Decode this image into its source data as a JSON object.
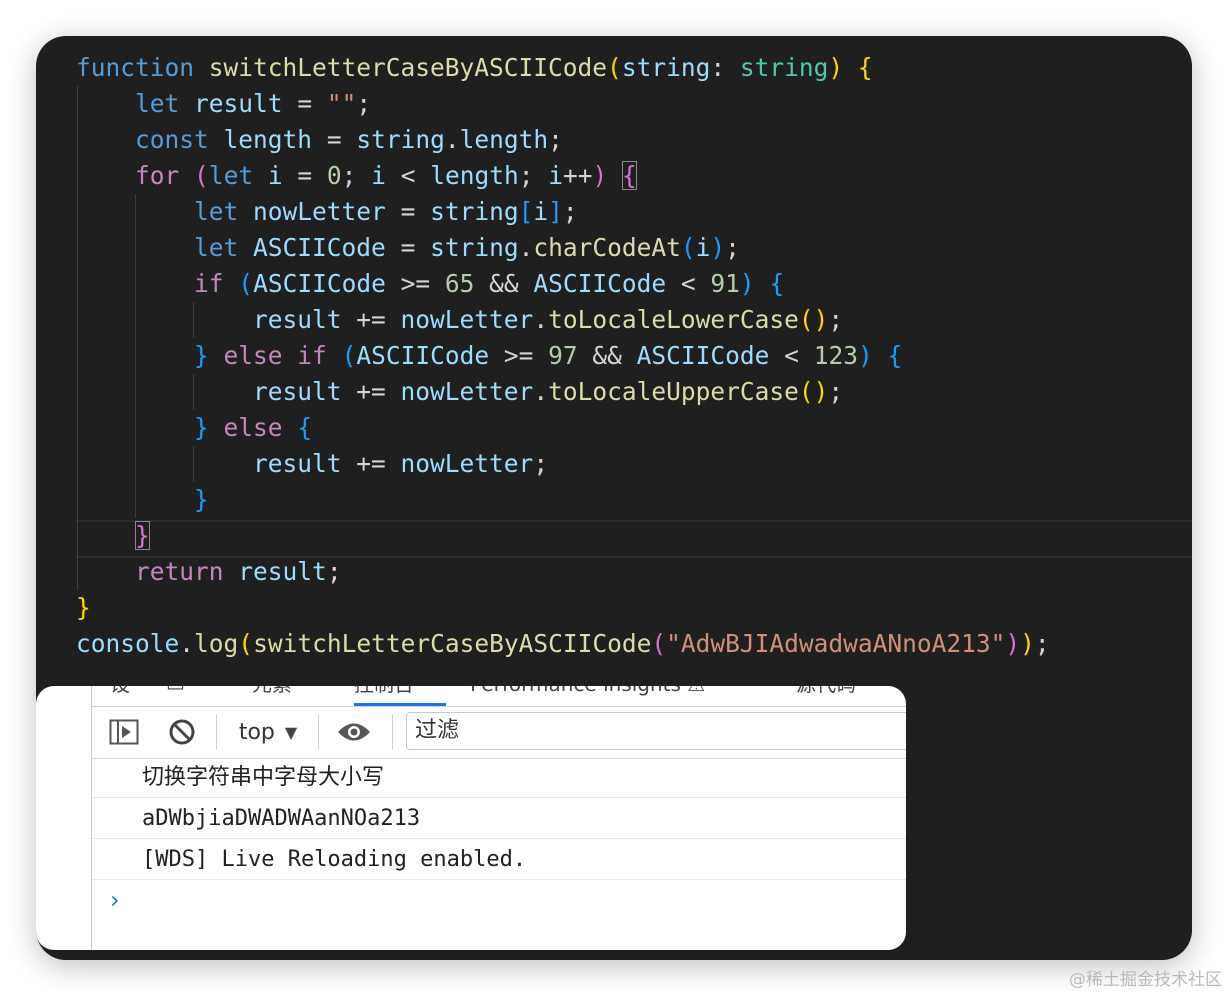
{
  "editor": {
    "lines": [
      [
        [
          "kw",
          "function"
        ],
        [
          "pn",
          " "
        ],
        [
          "fn",
          "switchLetterCaseByASCIICode"
        ],
        [
          "b1",
          "("
        ],
        [
          "vr",
          "string"
        ],
        [
          "pn",
          ": "
        ],
        [
          "ty",
          "string"
        ],
        [
          "b1",
          ")"
        ],
        [
          "pn",
          " "
        ],
        [
          "b1",
          "{"
        ]
      ],
      [
        [
          "pn",
          "    "
        ],
        [
          "kw",
          "let"
        ],
        [
          "pn",
          " "
        ],
        [
          "vr",
          "result"
        ],
        [
          "pn",
          " = "
        ],
        [
          "st",
          "\"\""
        ],
        [
          "pn",
          ";"
        ]
      ],
      [
        [
          "pn",
          "    "
        ],
        [
          "kw",
          "const"
        ],
        [
          "pn",
          " "
        ],
        [
          "vr",
          "length"
        ],
        [
          "pn",
          " = "
        ],
        [
          "vr",
          "string"
        ],
        [
          "pn",
          "."
        ],
        [
          "vr",
          "length"
        ],
        [
          "pn",
          ";"
        ]
      ],
      [
        [
          "pn",
          "    "
        ],
        [
          "ctl",
          "for"
        ],
        [
          "pn",
          " "
        ],
        [
          "b2",
          "("
        ],
        [
          "kw",
          "let"
        ],
        [
          "pn",
          " "
        ],
        [
          "vr",
          "i"
        ],
        [
          "pn",
          " = "
        ],
        [
          "nu",
          "0"
        ],
        [
          "pn",
          "; "
        ],
        [
          "vr",
          "i"
        ],
        [
          "pn",
          " < "
        ],
        [
          "vr",
          "length"
        ],
        [
          "pn",
          "; "
        ],
        [
          "vr",
          "i"
        ],
        [
          "pn",
          "++"
        ],
        [
          "b2",
          ")"
        ],
        [
          "pn",
          " "
        ],
        [
          "b2 bm",
          "{"
        ]
      ],
      [
        [
          "pn",
          "        "
        ],
        [
          "kw",
          "let"
        ],
        [
          "pn",
          " "
        ],
        [
          "vr",
          "nowLetter"
        ],
        [
          "pn",
          " = "
        ],
        [
          "vr",
          "string"
        ],
        [
          "b3",
          "["
        ],
        [
          "vr",
          "i"
        ],
        [
          "b3",
          "]"
        ],
        [
          "pn",
          ";"
        ]
      ],
      [
        [
          "pn",
          "        "
        ],
        [
          "kw",
          "let"
        ],
        [
          "pn",
          " "
        ],
        [
          "vr",
          "ASCIICode"
        ],
        [
          "pn",
          " = "
        ],
        [
          "vr",
          "string"
        ],
        [
          "pn",
          "."
        ],
        [
          "fn",
          "charCodeAt"
        ],
        [
          "b3",
          "("
        ],
        [
          "vr",
          "i"
        ],
        [
          "b3",
          ")"
        ],
        [
          "pn",
          ";"
        ]
      ],
      [
        [
          "pn",
          "        "
        ],
        [
          "ctl",
          "if"
        ],
        [
          "pn",
          " "
        ],
        [
          "b3",
          "("
        ],
        [
          "vr",
          "ASCIICode"
        ],
        [
          "pn",
          " >= "
        ],
        [
          "nu",
          "65"
        ],
        [
          "pn",
          " && "
        ],
        [
          "vr",
          "ASCIICode"
        ],
        [
          "pn",
          " < "
        ],
        [
          "nu",
          "91"
        ],
        [
          "b3",
          ")"
        ],
        [
          "pn",
          " "
        ],
        [
          "b3",
          "{"
        ]
      ],
      [
        [
          "pn",
          "            "
        ],
        [
          "vr",
          "result"
        ],
        [
          "pn",
          " += "
        ],
        [
          "vr",
          "nowLetter"
        ],
        [
          "pn",
          "."
        ],
        [
          "fn",
          "toLocaleLowerCase"
        ],
        [
          "b1",
          "()"
        ],
        [
          "pn",
          ";"
        ]
      ],
      [
        [
          "pn",
          "        "
        ],
        [
          "b3",
          "}"
        ],
        [
          "pn",
          " "
        ],
        [
          "ctl",
          "else if"
        ],
        [
          "pn",
          " "
        ],
        [
          "b3",
          "("
        ],
        [
          "vr",
          "ASCIICode"
        ],
        [
          "pn",
          " >= "
        ],
        [
          "nu",
          "97"
        ],
        [
          "pn",
          " && "
        ],
        [
          "vr",
          "ASCIICode"
        ],
        [
          "pn",
          " < "
        ],
        [
          "nu",
          "123"
        ],
        [
          "b3",
          ")"
        ],
        [
          "pn",
          " "
        ],
        [
          "b3",
          "{"
        ]
      ],
      [
        [
          "pn",
          "            "
        ],
        [
          "vr",
          "result"
        ],
        [
          "pn",
          " += "
        ],
        [
          "vr",
          "nowLetter"
        ],
        [
          "pn",
          "."
        ],
        [
          "fn",
          "toLocaleUpperCase"
        ],
        [
          "b1",
          "()"
        ],
        [
          "pn",
          ";"
        ]
      ],
      [
        [
          "pn",
          "        "
        ],
        [
          "b3",
          "}"
        ],
        [
          "pn",
          " "
        ],
        [
          "ctl",
          "else"
        ],
        [
          "pn",
          " "
        ],
        [
          "b3",
          "{"
        ]
      ],
      [
        [
          "pn",
          "            "
        ],
        [
          "vr",
          "result"
        ],
        [
          "pn",
          " += "
        ],
        [
          "vr",
          "nowLetter"
        ],
        [
          "pn",
          ";"
        ]
      ],
      [
        [
          "pn",
          "        "
        ],
        [
          "b3",
          "}"
        ]
      ],
      [
        [
          "pn",
          "    "
        ],
        [
          "b2 bm",
          "}"
        ]
      ],
      [
        [
          "pn",
          "    "
        ],
        [
          "ctl",
          "return"
        ],
        [
          "pn",
          " "
        ],
        [
          "vr",
          "result"
        ],
        [
          "pn",
          ";"
        ]
      ],
      [
        [
          "b1",
          "}"
        ]
      ],
      [
        [
          "vr",
          "console"
        ],
        [
          "pn",
          "."
        ],
        [
          "fn",
          "log"
        ],
        [
          "b1",
          "("
        ],
        [
          "fn",
          "switchLetterCaseByASCIICode"
        ],
        [
          "b2",
          "("
        ],
        [
          "st",
          "\"AdwBJIAdwadwaANnoA213\""
        ],
        [
          "b2",
          ")"
        ],
        [
          "b1",
          ")"
        ],
        [
          "pn",
          ";"
        ]
      ]
    ]
  },
  "devtools": {
    "tabs": [
      "设",
      "元素",
      "控制台",
      "Performance insights ⚠",
      "源代码"
    ],
    "context_label": "top",
    "filter_placeholder": "过滤",
    "messages": [
      "切换字符串中字母大小写",
      "aDWbjiaDWADWAanNOa213",
      "[WDS] Live Reloading enabled."
    ],
    "prompt": "›"
  },
  "watermark": "@稀土掘金技术社区",
  "colors": {
    "editor_bg": "#1f1f1f",
    "keyword": "#569cd6",
    "control": "#c586c0",
    "function": "#dcdcaa",
    "variable": "#9cdcfe",
    "string": "#ce9178",
    "number": "#b5cea8",
    "devtools_accent": "#1a73e8"
  }
}
